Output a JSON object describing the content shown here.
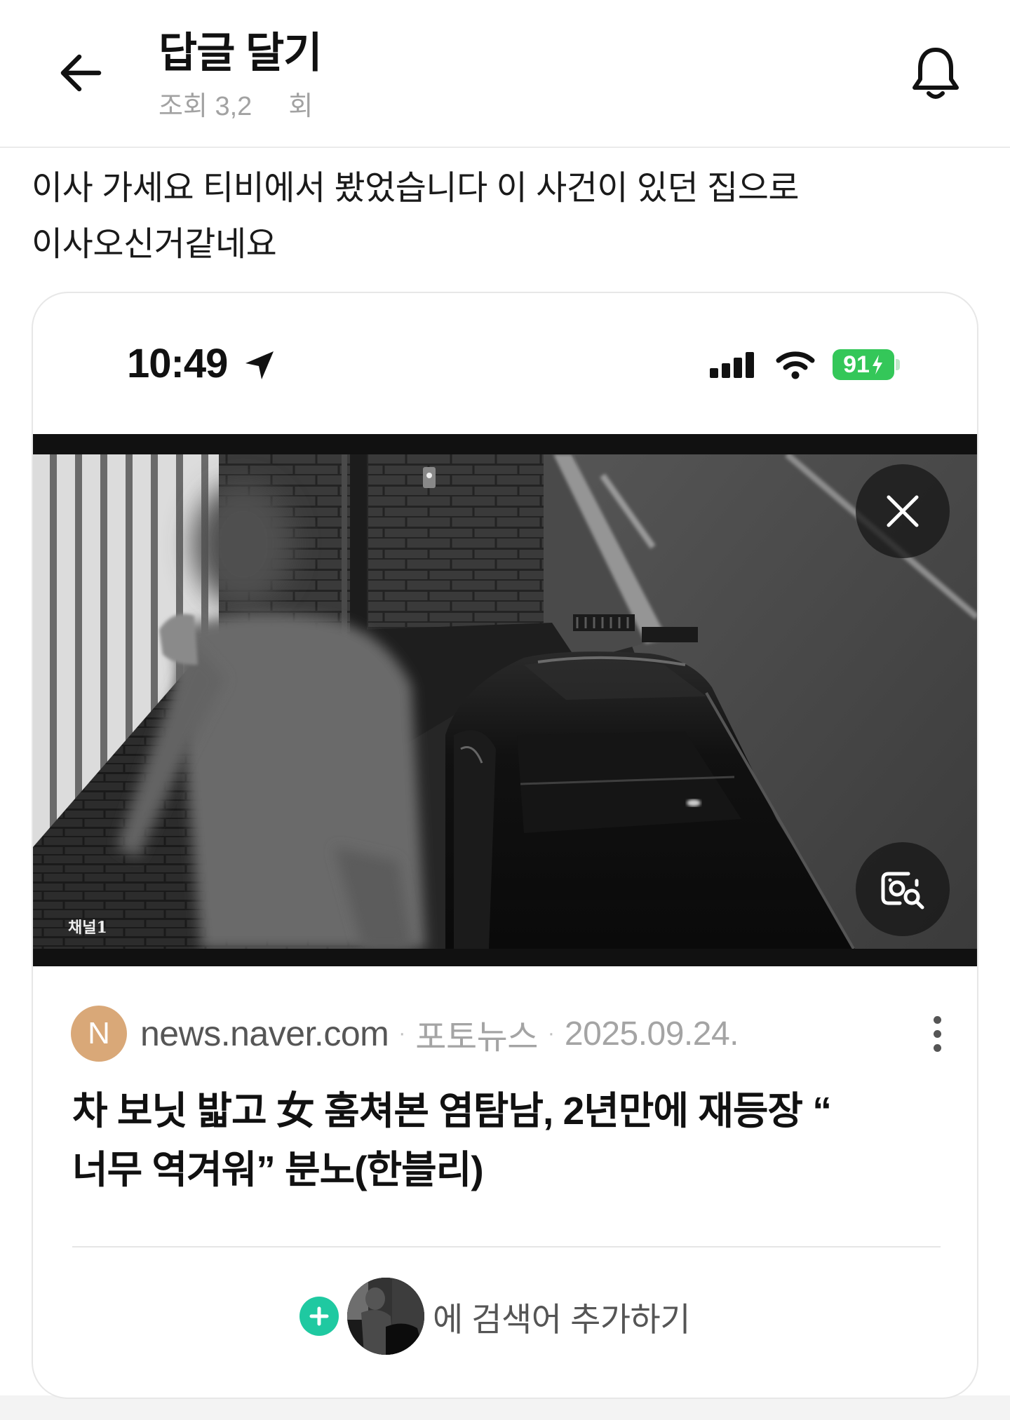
{
  "header": {
    "title": "답글 달기",
    "views_prefix": "조회 3,2",
    "views_suffix": "회",
    "back_icon": "arrow-left-icon",
    "bell_icon": "bell-icon"
  },
  "comment": {
    "lines": [
      "이사 가세요 티비에서 봤었습니다 이 사건이 있던 집으로",
      "이사오신거같네요"
    ]
  },
  "card": {
    "status_bar": {
      "time": "10:49",
      "battery": "91",
      "battery_color": "#34C759",
      "icons": [
        "location-arrow-icon",
        "signal-icon",
        "wifi-icon",
        "battery-icon"
      ]
    },
    "photo": {
      "camera_label": "채널1",
      "close_icon": "close-icon",
      "lens_icon": "image-search-icon"
    },
    "source": {
      "avatar_letter": "N",
      "avatar_color": "#D9A878",
      "domain": "news.naver.com",
      "separator": "·",
      "category": "포토뉴스",
      "date": "2025.09.24.",
      "menu_icon": "more-vertical-icon"
    },
    "headline_lines": [
      "차 보닛 밟고 女 훔쳐본 염탐남, 2년만에 재등장 “",
      "너무 역겨워” 분노(한블리)"
    ],
    "search_add": {
      "plus_icon": "plus-circle-icon",
      "plus_color": "#1FC9A1",
      "label": "에 검색어 추가하기"
    }
  }
}
